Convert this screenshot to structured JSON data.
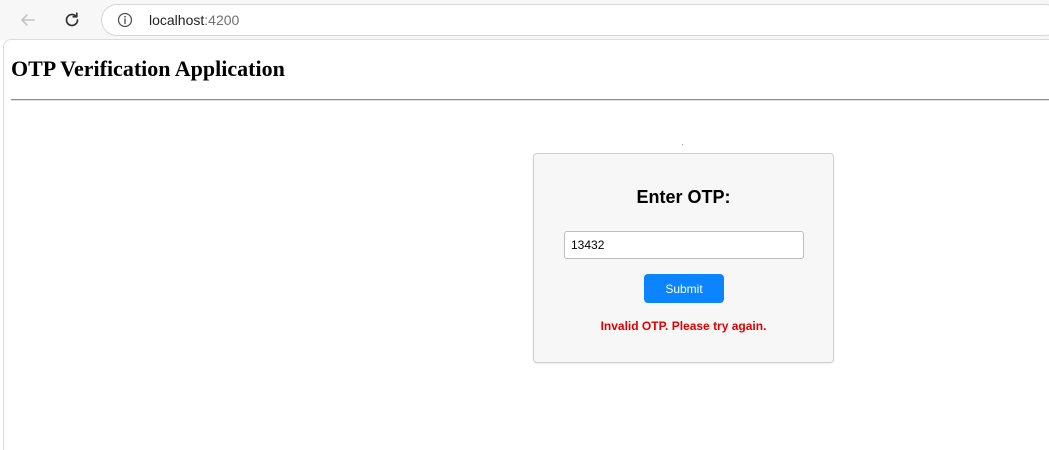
{
  "browser": {
    "url_host": "localhost",
    "url_port": ":4200",
    "icons": {
      "back": "back-arrow-icon",
      "reload": "reload-icon",
      "info": "info-icon"
    }
  },
  "page": {
    "title": "OTP Verification Application"
  },
  "otp_form": {
    "heading": "Enter OTP:",
    "input_value": "13432",
    "submit_label": "Submit",
    "error_message": "Invalid OTP. Please try again."
  },
  "colors": {
    "primary_button": "#0a84ff",
    "error_text": "#e00000",
    "card_background": "#f7f7f7"
  }
}
